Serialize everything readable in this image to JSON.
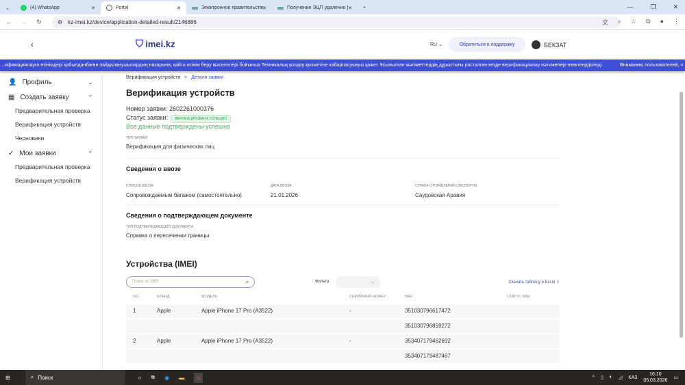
{
  "browser": {
    "tabs": [
      {
        "title": "(4) WhatsApp"
      },
      {
        "title": "Portal"
      },
      {
        "title": "Электронное правительство"
      },
      {
        "title": "Получение ЭЦП удаленно | Э"
      }
    ],
    "url": "kz-imei.kz/device/application-detailed-result/2146886"
  },
  "header": {
    "logo": "imei.kz",
    "lang": "RU",
    "support": "Обратиться в поддержку",
    "user": "БЕКЗАТ"
  },
  "banner": {
    "text_kz": "…ификациялауға өтінімдері қабылданбаған пайдаланушылардың назарына, қайта өтінім беру мәселелері бойынша Техникалық қолдау қызметіне хабарласуыңыз қажет. Ұсынылған мәліметтердің дұрыстығы расталған кезде верификациялау нәтижелері өзектендіріледі.",
    "text_ru": "Вниманию пользователей, ч"
  },
  "sidebar": {
    "profile": "Профиль",
    "create": "Создать заявку",
    "create_items": [
      "Предварительная проверка",
      "Верификация устройств",
      "Черновики"
    ],
    "my": "Мои заявки",
    "my_items": [
      "Предварительная проверка",
      "Верификация устройств"
    ]
  },
  "breadcrumb": {
    "parent": "Верификация устройств",
    "sep": ">",
    "current": "Детали заявки"
  },
  "page": {
    "title": "Верификация устройств",
    "number_label": "Номер заявки:",
    "number": "2602261000376",
    "status_label": "Статус заявки:",
    "status": "ВЕРИФИЦИРОВАНА УСПЕШНО",
    "status_msg": "Все данные подтверждены успешно",
    "type_label": "тип заявки",
    "type": "Верификация для физических лиц"
  },
  "import": {
    "title": "Сведения о ввозе",
    "method_label": "способ ввоза",
    "method": "Сопровождаемым багажом (самостоятельно)",
    "date_label": "дата ввоза",
    "date": "21.01.2026",
    "country_label": "страна отправления (экспорта)",
    "country": "Саудовская Аравия"
  },
  "doc": {
    "title": "Сведения о подтверждающем документе",
    "type_label": "тип подтверждающего документа",
    "type": "Справка о пересечении границы"
  },
  "devices": {
    "title": "Устройства (IMEI)",
    "search_placeholder": "Поиск по IMEI",
    "filter_label": "Фильтр:",
    "excel": "Скачать таблицу в Excel",
    "columns": [
      "NO.",
      "БРЕНД",
      "МОДЕЛЬ",
      "СЕРИЙНЫЙ НОМЕР",
      "IMEI",
      "СТАТУС IMEI"
    ],
    "rows": [
      {
        "no": "1",
        "brand": "Apple",
        "model": "Apple iPhone 17 Pro (A3522)",
        "serial": "-",
        "imei": "351030796617472"
      },
      {
        "no": "",
        "brand": "",
        "model": "",
        "serial": "",
        "imei": "351030796859272"
      },
      {
        "no": "2",
        "brand": "Apple",
        "model": "Apple iPhone 17 Pro (A3522)",
        "serial": "-",
        "imei": "353407179462692"
      },
      {
        "no": "",
        "brand": "",
        "model": "",
        "serial": "",
        "imei": "353407179487467"
      }
    ]
  },
  "taskbar": {
    "search": "Поиск",
    "lang": "КАЗ",
    "time": "16:10",
    "date": "05.03.2026"
  }
}
